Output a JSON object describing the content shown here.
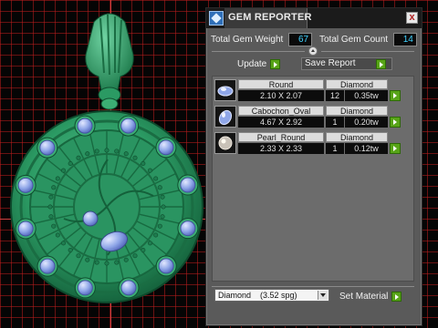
{
  "panel": {
    "title": "GEM REPORTER",
    "close_label": "x",
    "total_weight_label": "Total Gem Weight",
    "total_weight_value": "67",
    "total_count_label": "Total Gem Count",
    "total_count_value": "14",
    "update_label": "Update",
    "save_report_label": "Save Report",
    "gems": [
      {
        "name": "Round",
        "size": "2.10 X 2.07",
        "material": "Diamond",
        "count": "12",
        "weight": "0.35tw",
        "thumb": "round-gem-icon"
      },
      {
        "name": "Cabochon_Oval",
        "size": "4.67 X 2.92",
        "material": "Diamond",
        "count": "1",
        "weight": "0.20tw",
        "thumb": "oval-gem-icon"
      },
      {
        "name": "Pearl_Round",
        "size": "2.33 X 2.33",
        "material": "Diamond",
        "count": "1",
        "weight": "0.12tw",
        "thumb": "pearl-icon"
      }
    ],
    "material_name": "Diamond",
    "material_spg": "(3.52 spg)",
    "set_material_label": "Set Material"
  },
  "colors": {
    "pendant_green": "#2b9a63",
    "gem_blue": "#8fa6e8",
    "accent_cyan": "#3fd2ff",
    "go_green": "#58a418"
  }
}
